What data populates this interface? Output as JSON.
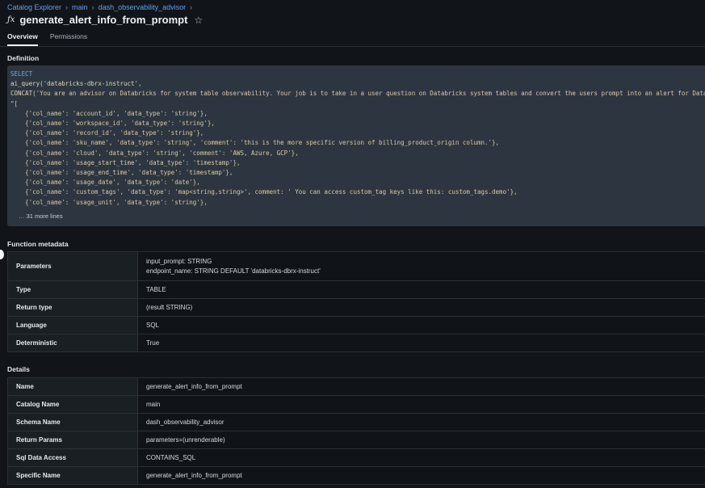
{
  "breadcrumb": {
    "items": [
      "Catalog Explorer",
      "main",
      "dash_observability_advisor"
    ],
    "separator": "›"
  },
  "header": {
    "icon": "function-icon",
    "title": "generate_alert_info_from_prompt",
    "star_icon": "star-outline-icon"
  },
  "tabs": [
    {
      "label": "Overview",
      "active": true
    },
    {
      "label": "Permissions",
      "active": false
    }
  ],
  "definition": {
    "heading": "Definition",
    "more_lines": "… 31 more lines",
    "code": {
      "select": "SELECT",
      "ai_query": "ai_query('databricks-dbrx-instruct',",
      "concat_fn": "CONCAT",
      "concat_rest": "('You are an advisor on Databricks for system table observability. Your job is to take in a user question on Databricks system tables and convert the users prompt into an alert for Databricks",
      "open_bracket": "\"[",
      "rows": [
        "    {'col_name': 'account_id', 'data_type': 'string'},",
        "    {'col_name': 'workspace_id', 'data_type': 'string'},",
        "    {'col_name': 'record_id', 'data_type': 'string'},",
        "    {'col_name': 'sku_name', 'data_type': 'string', 'comment': 'this is the more specific version of billing_product_origin column.'},",
        "    {'col_name': 'cloud', 'data_type': 'string', 'comment': 'AWS, Azure, GCP'},",
        "    {'col_name': 'usage_start_time', 'data_type': 'timestamp'},",
        "    {'col_name': 'usage_end_time', 'data_type': 'timestamp'},",
        "    {'col_name': 'usage_date', 'data_type': 'date'},",
        "    {'col_name': 'custom_tags', 'data_type': 'map<string,string>', comment: ' You can access custom_tag keys like this: custom_tags.demo'},",
        "    {'col_name': 'usage_unit', 'data_type': 'string'},"
      ]
    }
  },
  "function_metadata": {
    "heading": "Function metadata",
    "params_label": "Parameters",
    "params_line1": "input_prompt: STRING",
    "params_line2": "endpoint_name: STRING DEFAULT 'databricks-dbrx-instruct'",
    "rows": [
      {
        "label": "Type",
        "value": "TABLE"
      },
      {
        "label": "Return type",
        "value": "(result STRING)"
      },
      {
        "label": "Language",
        "value": "SQL"
      },
      {
        "label": "Deterministic",
        "value": "True"
      }
    ]
  },
  "details": {
    "heading": "Details",
    "rows": [
      {
        "label": "Name",
        "value": "generate_alert_info_from_prompt"
      },
      {
        "label": "Catalog Name",
        "value": "main"
      },
      {
        "label": "Schema Name",
        "value": "dash_observability_advisor"
      },
      {
        "label": "Return Params",
        "value": "parameters=(unrenderable)"
      },
      {
        "label": "Sql Data Access",
        "value": "CONTAINS_SQL"
      },
      {
        "label": "Specific Name",
        "value": "generate_alert_info_from_prompt"
      }
    ]
  },
  "colors": {
    "background": "#111519",
    "link": "#5ea1f0",
    "code_background": "#2d3640",
    "keyword": "#6ca9f0"
  }
}
